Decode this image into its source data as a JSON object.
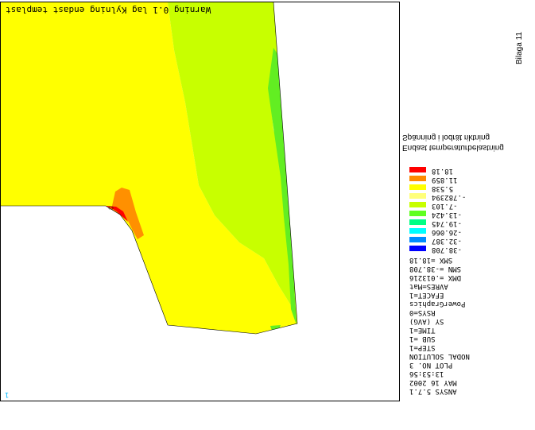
{
  "plot": {
    "title": "Warning 0.1 lag Kylning endast templast",
    "coord_mark": "1"
  },
  "page_label": "Bilaga 11",
  "legend": {
    "title_line_1": "Endast temperaturbelastning",
    "title_line_2": "Spänning i lodrät riktning",
    "items": [
      {
        "color": "#ff0000",
        "value": "18.18"
      },
      {
        "color": "#ff8a00",
        "value": "11.859"
      },
      {
        "color": "#ffff00",
        "value": "5.538"
      },
      {
        "color": "#ffff7a",
        "value": "-.782394"
      },
      {
        "color": "#c7ff00",
        "value": "-7.103"
      },
      {
        "color": "#60ff20",
        "value": "-13.424"
      },
      {
        "color": "#00ff85",
        "value": "-19.745"
      },
      {
        "color": "#00ffff",
        "value": "-26.066"
      },
      {
        "color": "#008cff",
        "value": "-32.387"
      },
      {
        "color": "#0000ff",
        "value": "-38.708"
      }
    ]
  },
  "meta": [
    "SMX =18.18",
    "SMN =-38.708",
    "DMX =.013216",
    "AVRES=Mat",
    "EFACET=1",
    "PowerGraphics",
    "RSYS=0",
    "SY        (AVG)",
    "TIME=1",
    "SUB =1",
    "STEP=1",
    "NODAL  SOLUTION",
    "PLOT NO.    3",
    "13:53:56",
    "MAY 16 2002",
    "ANSYS 5.7.1"
  ]
}
